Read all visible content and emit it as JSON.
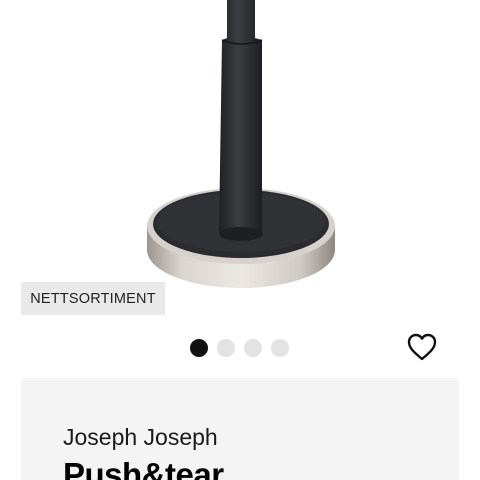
{
  "badge": {
    "label": "NETTSORTIMENT"
  },
  "carousel": {
    "image_count": 4,
    "active_index": 0
  },
  "favorite": {
    "icon": "heart-outline-icon"
  },
  "product": {
    "brand": "Joseph Joseph",
    "name": "Push&tear"
  },
  "colors": {
    "base_metal": "#c9c4bf",
    "pole": "#2b2d31",
    "badge_bg": "#e9e9e9",
    "panel_bg": "#f4f4f4",
    "active_dot": "#111111",
    "inactive_dot": "#e3e3e3"
  }
}
